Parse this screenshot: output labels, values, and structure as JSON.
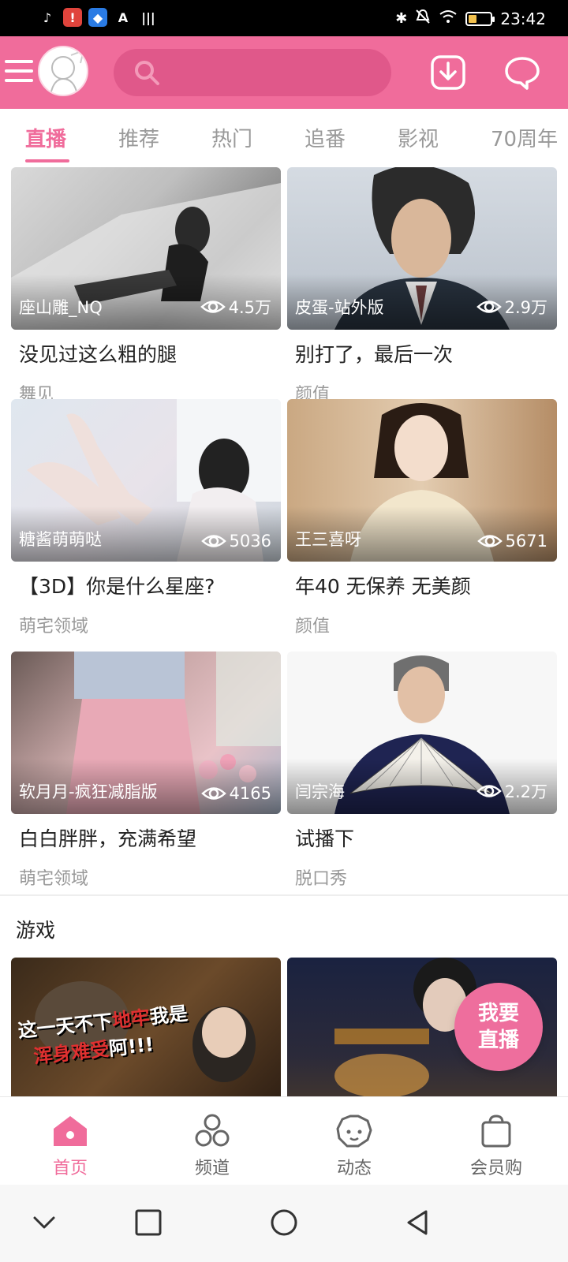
{
  "status": {
    "time": "23:42"
  },
  "tabs": [
    {
      "label": "直播"
    },
    {
      "label": "推荐"
    },
    {
      "label": "热门"
    },
    {
      "label": "追番"
    },
    {
      "label": "影视"
    },
    {
      "label": "70周年"
    }
  ],
  "cards": [
    {
      "streamer": "座山雕_NQ",
      "viewers": "4.5万",
      "title": "没见过这么粗的腿",
      "category": "舞见"
    },
    {
      "streamer": "皮蛋-站外版",
      "viewers": "2.9万",
      "title": "别打了，最后一次",
      "category": "颜值"
    },
    {
      "streamer": "糖酱萌萌哒",
      "viewers": "5036",
      "title": "【3D】你是什么星座?",
      "category": "萌宅领域"
    },
    {
      "streamer": "王三喜呀",
      "viewers": "5671",
      "title": "年40 无保养 无美颜",
      "category": "颜值"
    },
    {
      "streamer": "软月月-疯狂减脂版",
      "viewers": "4165",
      "title": "白白胖胖，充满希望",
      "category": "萌宅领域"
    },
    {
      "streamer": "闫宗海",
      "viewers": "2.2万",
      "title": "试播下",
      "category": "脱口秀"
    }
  ],
  "section": {
    "title": "游戏"
  },
  "game_cards": [
    {
      "overlay_line1": "这一天不下",
      "overlay_red1": "地牢",
      "overlay_line1b": "我是",
      "overlay_red2": "浑身难受",
      "overlay_line2b": "阿!!!"
    }
  ],
  "fab": {
    "line1": "我要",
    "line2": "直播"
  },
  "bottom_nav": [
    {
      "label": "首页"
    },
    {
      "label": "频道"
    },
    {
      "label": "动态"
    },
    {
      "label": "会员购"
    }
  ]
}
